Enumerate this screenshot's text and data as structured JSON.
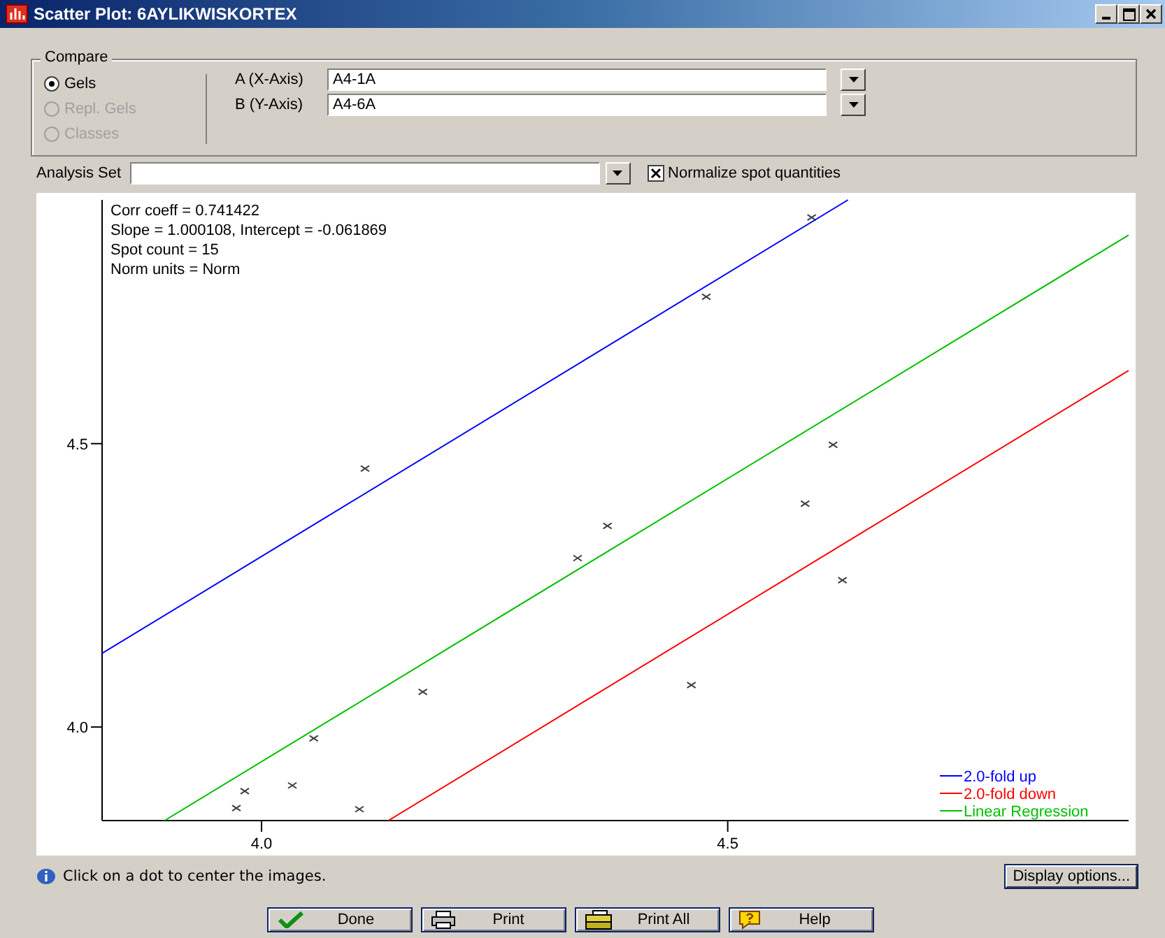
{
  "window": {
    "title": "Scatter Plot: 6AYLIKWISKORTEX"
  },
  "compare": {
    "title": "Compare",
    "options": [
      {
        "label": "Gels",
        "selected": true,
        "disabled": false
      },
      {
        "label": "Repl. Gels",
        "selected": false,
        "disabled": true
      },
      {
        "label": "Classes",
        "selected": false,
        "disabled": true
      }
    ],
    "axes": [
      {
        "label": "A (X-Axis)",
        "value": "A4-1A"
      },
      {
        "label": "B (Y-Axis)",
        "value": "A4-6A"
      }
    ]
  },
  "analysis_set": {
    "label": "Analysis Set"
  },
  "normalize": {
    "label": "Normalize spot quantities",
    "checked": true
  },
  "plot": {
    "stats": [
      "Corr coeff = 0.741422",
      "Slope = 1.000108, Intercept = -0.061869",
      "Spot count = 15",
      "Norm units = Norm"
    ],
    "chart_data": {
      "type": "scatter",
      "legend": true,
      "xlim": [
        3.829,
        4.93
      ],
      "ylim": [
        3.835,
        4.93
      ],
      "xticks": [
        {
          "value": 4.0,
          "label": "4.0"
        },
        {
          "value": 4.5,
          "label": "4.5"
        }
      ],
      "yticks": [
        {
          "value": 4.0,
          "label": "4.0"
        },
        {
          "value": 4.5,
          "label": "4.5"
        }
      ],
      "series": [
        {
          "type": "scatter",
          "color": "#404040",
          "x": [
            3.973,
            3.982,
            4.033,
            4.056,
            4.105,
            4.111,
            4.173,
            4.339,
            4.371,
            4.461,
            4.477,
            4.583,
            4.59,
            4.613,
            4.623
          ],
          "values": [
            3.857,
            3.887,
            3.897,
            3.98,
            3.855,
            4.456,
            4.062,
            4.298,
            4.355,
            4.074,
            4.759,
            4.394,
            4.899,
            4.498,
            4.259
          ]
        },
        {
          "type": "line",
          "name": "2.0-fold up",
          "color": "#0000ff",
          "x": [
            3.829,
            4.629
          ],
          "values": [
            4.13,
            4.93
          ]
        },
        {
          "type": "line",
          "name": "2.0-fold down",
          "color": "#ff0000",
          "x": [
            4.136,
            4.93
          ],
          "values": [
            3.835,
            4.629
          ]
        },
        {
          "type": "line",
          "name": "Linear Regression",
          "color": "#00c000",
          "x": [
            3.896,
            4.93
          ],
          "values": [
            3.835,
            4.868
          ]
        }
      ]
    }
  },
  "info": "Click on a dot to center the images.",
  "display_options": "Display options...",
  "buttons": [
    {
      "kind": "done",
      "label": "Done"
    },
    {
      "kind": "print",
      "label": "Print"
    },
    {
      "kind": "print_all",
      "label": "Print All"
    },
    {
      "kind": "help",
      "label": "Help"
    }
  ]
}
